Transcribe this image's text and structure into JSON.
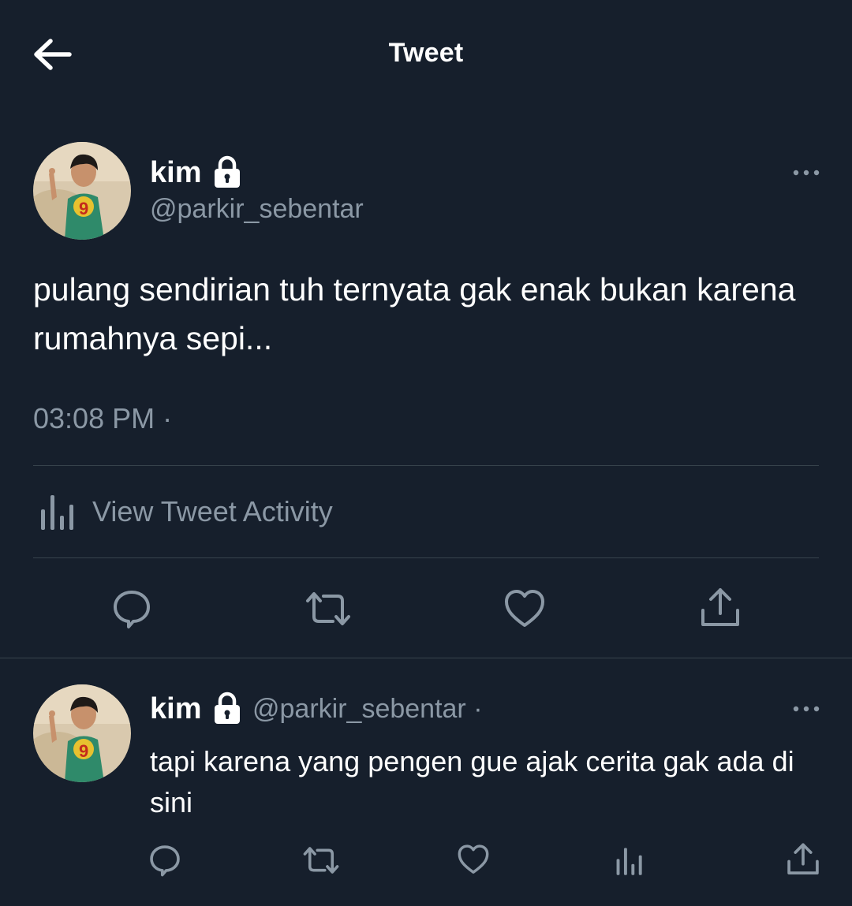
{
  "header": {
    "title": "Tweet",
    "back_icon": "arrow-left-icon"
  },
  "tweet": {
    "name": "kim",
    "handle": "@parkir_sebentar",
    "text": "pulang sendirian tuh ternyata gak enak bukan karena rumahnya sepi...",
    "timestamp": "03:08 PM ·",
    "activity_label": "View Tweet Activity",
    "protected_icon": "lock-icon",
    "actions": [
      "reply-icon",
      "retweet-icon",
      "like-icon",
      "share-icon"
    ]
  },
  "reply": {
    "name": "kim",
    "handle": "@parkir_sebentar ·",
    "text": "tapi karena yang pengen gue ajak cerita gak ada di sini",
    "actions": [
      "reply-icon",
      "retweet-icon",
      "like-icon",
      "analytics-icon",
      "share-icon"
    ]
  },
  "colors": {
    "background": "#161f2c",
    "text_primary": "#ffffff",
    "text_secondary": "#8b98a5",
    "divider": "#38444d"
  }
}
